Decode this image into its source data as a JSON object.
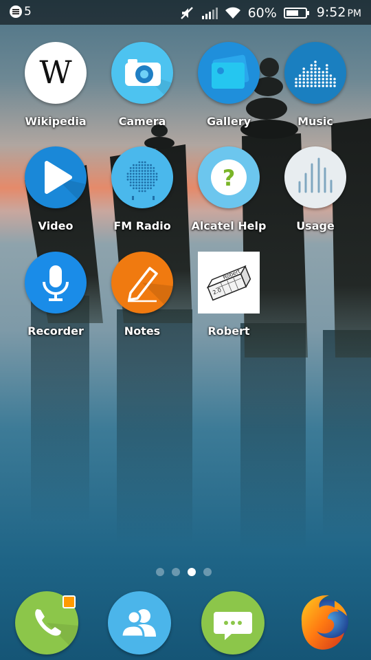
{
  "status_bar": {
    "notification_count": "5",
    "battery_percent": "60%",
    "time": "9:52",
    "ampm": "PM",
    "icons": [
      "notification-icon",
      "mute-icon",
      "signal-icon",
      "wifi-icon",
      "battery-icon"
    ]
  },
  "apps": [
    {
      "label": "Wikipedia",
      "icon": "wikipedia-icon"
    },
    {
      "label": "Camera",
      "icon": "camera-icon"
    },
    {
      "label": "Gallery",
      "icon": "gallery-icon"
    },
    {
      "label": "Music",
      "icon": "music-icon"
    },
    {
      "label": "Video",
      "icon": "video-icon"
    },
    {
      "label": "FM Radio",
      "icon": "fm-radio-icon"
    },
    {
      "label": "Alcatel Help",
      "icon": "help-icon"
    },
    {
      "label": "Usage",
      "icon": "usage-icon"
    },
    {
      "label": "Recorder",
      "icon": "microphone-icon"
    },
    {
      "label": "Notes",
      "icon": "pencil-icon"
    },
    {
      "label": "Robert",
      "icon": "eraser-icon",
      "icon_text": "Robert",
      "icon_text2": "2.0"
    }
  ],
  "pages": {
    "count": 4,
    "active": 3
  },
  "dock": [
    {
      "name": "Phone",
      "icon": "phone-icon",
      "badge": true
    },
    {
      "name": "Contacts",
      "icon": "contacts-icon"
    },
    {
      "name": "Messages",
      "icon": "messages-icon"
    },
    {
      "name": "Firefox",
      "icon": "firefox-icon"
    }
  ],
  "colors": {
    "wiki_bg": "#ffffff",
    "camera": "#4dc3f0",
    "gallery": "#1f8fdb",
    "music": "#1a7fc0",
    "video": "#1a88d8",
    "fm_radio": "#4ab8ec",
    "help": "#6cc6ee",
    "usage": "#e8edf0",
    "recorder": "#1a8ce8",
    "notes": "#f07a10",
    "phone": "#8cc64a",
    "contacts": "#4bb5ea",
    "messages": "#8cc64a",
    "badge": "#ff9a00"
  }
}
